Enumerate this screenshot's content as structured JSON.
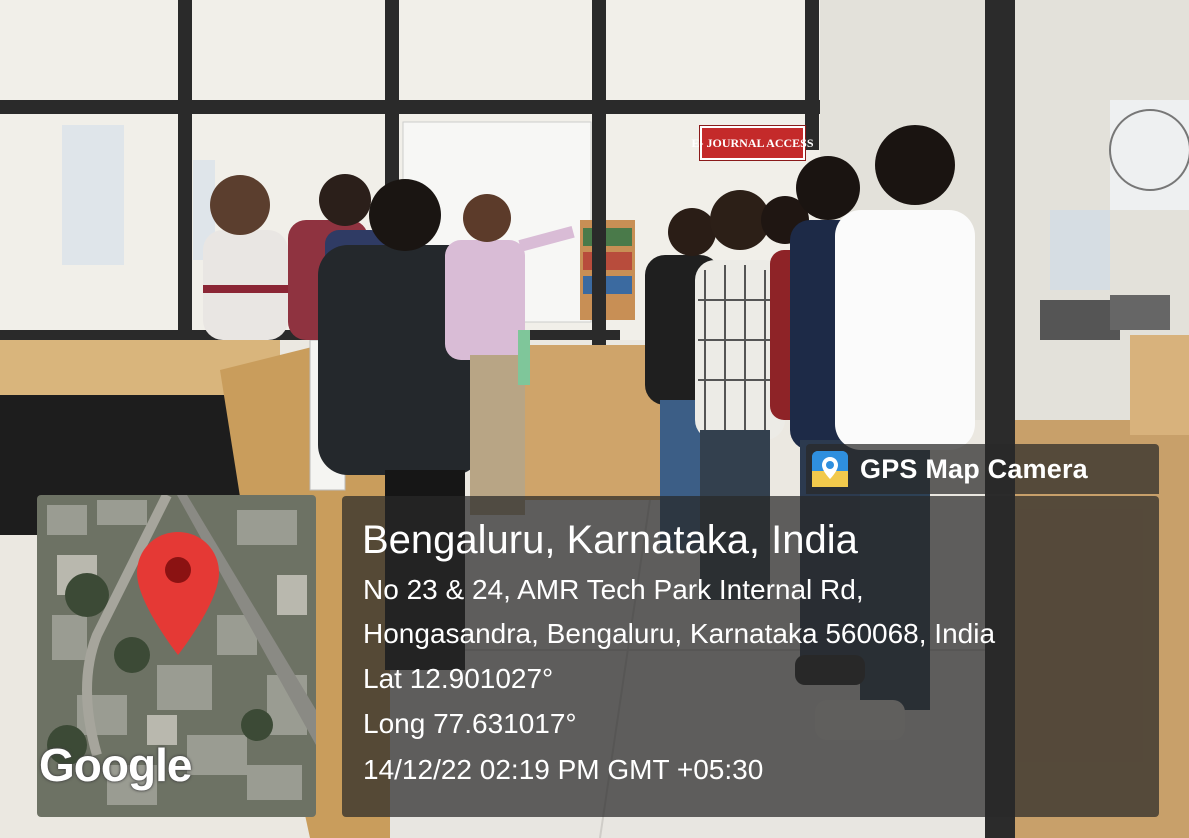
{
  "sign": {
    "text": "E- JOURNAL ACCESS"
  },
  "watermark": {
    "app_name": "GPS Map Camera",
    "icon": "gps-map-camera-icon"
  },
  "map": {
    "provider_logo": "Google",
    "marker_icon": "map-pin-icon",
    "marker_color": "#e53935"
  },
  "location": {
    "city": "Bengaluru, Karnataka, India",
    "address_line1": "No 23 & 24, AMR Tech Park Internal Rd,",
    "address_line2": "Hongasandra, Bengaluru, Karnataka 560068, India",
    "latitude": "Lat 12.901027°",
    "longitude": "Long 77.631017°",
    "timestamp": "14/12/22 02:19 PM GMT +05:30"
  },
  "colors": {
    "overlay": "#282828",
    "sign_red": "#c42a2a",
    "gps_icon_blue": "#2f8fde"
  }
}
